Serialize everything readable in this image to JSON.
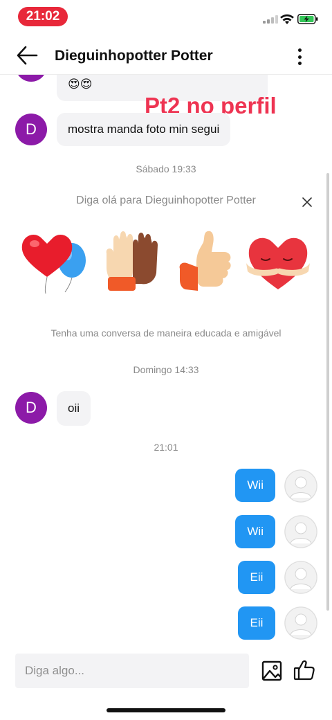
{
  "status_bar": {
    "time": "21:02",
    "battery_charging": true
  },
  "header": {
    "title": "Dieguinhopotter Potter"
  },
  "overlay_text": "Pt2 no perfil",
  "contact": {
    "avatar_letter": "D",
    "avatar_color": "#8c1aa8"
  },
  "messages": {
    "m1": {
      "text": "😍😍"
    },
    "m2": {
      "text": "mostra manda foto min segui"
    },
    "stamp_sabado": "Sábado 19:33",
    "greet": "Diga olá para Dieguinhopotter Potter",
    "stickers": [
      "balloons-heart-icon",
      "high-five-icon",
      "thumbs-up-icon",
      "hugging-heart-icon"
    ],
    "hint": "Tenha uma conversa de maneira educada e amigável",
    "stamp_domingo": "Domingo 14:33",
    "m3": {
      "text": "oii"
    },
    "stamp_now": "21:01",
    "sent": [
      {
        "text": "Wii"
      },
      {
        "text": "Wii"
      },
      {
        "text": "Eii"
      },
      {
        "text": "Eii"
      }
    ]
  },
  "input": {
    "placeholder": "Diga algo...",
    "value": ""
  },
  "colors": {
    "accent": "#2196f3",
    "status_pill": "#e8283a",
    "overlay": "#ee3452"
  }
}
